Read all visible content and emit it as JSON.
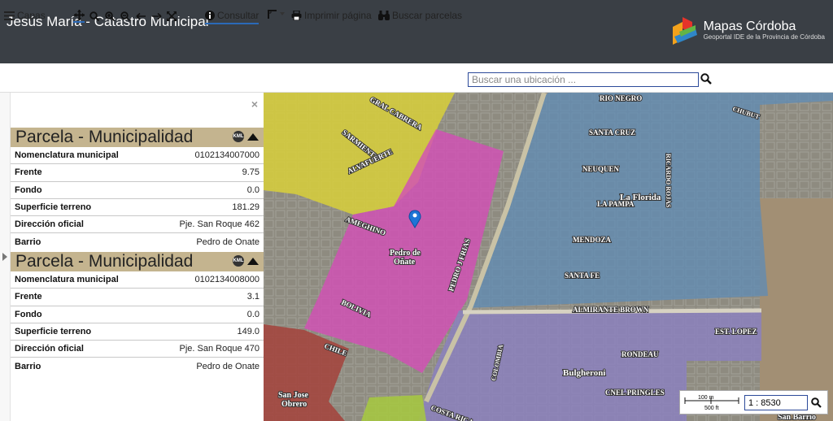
{
  "header": {
    "title": "Jesús María - Catastro Municipal",
    "brand_name": "Mapas Córdoba",
    "brand_sub": "Geoportal IDE de la Provincia de Córdoba"
  },
  "toolbar": {
    "layers_label": "Capas",
    "consult_label": "Consultar",
    "print_label": "Imprimir página",
    "parcel_search_label": "Buscar parcelas",
    "search_placeholder": "Buscar una ubicación ..."
  },
  "panel": {
    "close": "×",
    "parcels": [
      {
        "title": "Parcela - Municipalidad",
        "kml": "KML",
        "rows": [
          {
            "key": "Nomenclatura municipal",
            "value": "0102134007000"
          },
          {
            "key": "Frente",
            "value": "9.75"
          },
          {
            "key": "Fondo",
            "value": "0.0"
          },
          {
            "key": "Superficie terreno",
            "value": "181.29"
          },
          {
            "key": "Dirección oficial",
            "value": "Pje. San Roque 462"
          },
          {
            "key": "Barrio",
            "value": "Pedro de Onate"
          }
        ]
      },
      {
        "title": "Parcela - Municipalidad",
        "kml": "KML",
        "rows": [
          {
            "key": "Nomenclatura municipal",
            "value": "0102134008000"
          },
          {
            "key": "Frente",
            "value": "3.1"
          },
          {
            "key": "Fondo",
            "value": "0.0"
          },
          {
            "key": "Superficie terreno",
            "value": "149.0"
          },
          {
            "key": "Dirección oficial",
            "value": "Pje. San Roque 470"
          },
          {
            "key": "Barrio",
            "value": "Pedro de Onate"
          }
        ]
      }
    ]
  },
  "map": {
    "labels": {
      "rio_negro": "RIO NEGRO",
      "chubut": "CHUBUT",
      "santa_cruz": "SANTA CRUZ",
      "neuquen": "NEUQUEN",
      "la_florida": "La Florida",
      "la_pampa": "LA PAMPA",
      "mendoza": "MENDOZA",
      "santa_fe": "SANTA FE",
      "almirante_brown": "ALMIRANTE BROWN",
      "rondeau": "RONDEAU",
      "bulgheroni": "Bulgheroni",
      "cnel_pringles": "CNEL PRINGLES",
      "est_lopez": "EST. LOPEZ",
      "pedro_de_onate": "Pedro de",
      "pedro_de_onate2": "Oñate",
      "ameghino": "AMEGHINO",
      "sarmiento": "SARMIENTO",
      "alvafuerte": "ALVAFUERTE",
      "gral_cabrera": "GRAL CABRERA",
      "pedro_j_frias": "PEDRO J FRIAS",
      "bolivia": "BOLIVIA",
      "chile": "CHILE",
      "san_jose": "San Jose",
      "obrero": "Obrero",
      "costa_rica": "COSTA RICA",
      "san_barrio": "San Barrio",
      "ricardo_rojas": "RICARDO ROJAS",
      "colombia": "COLOMBIA"
    },
    "scale_100m": "100 m",
    "scale_500ft": "500 ft",
    "scale_value": "1 : 8530"
  },
  "colors": {
    "header_bg": "#3a3f45",
    "parcel_header": "#c4b48f",
    "zone_yellow": "#d8cf3a",
    "zone_magenta": "#d24fb6",
    "zone_blue": "#5d8bb5",
    "zone_purple": "#8b7fc1",
    "zone_red": "#a5423b",
    "zone_green": "#a7c93e"
  }
}
